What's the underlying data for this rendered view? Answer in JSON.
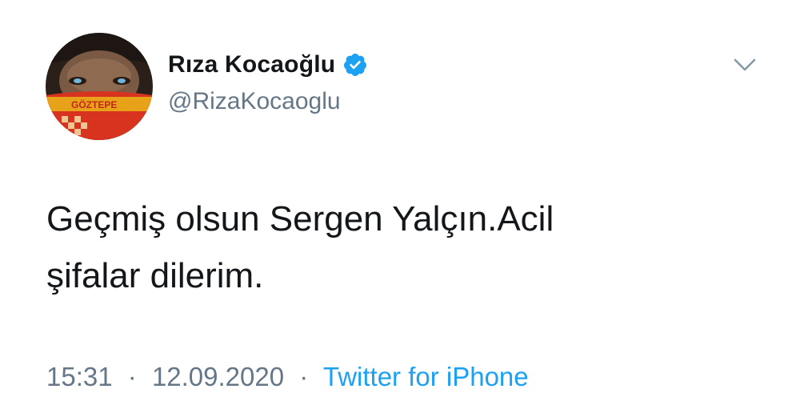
{
  "author": {
    "display_name": "Rıza Kocaoğlu",
    "handle": "@RizaKocaoglu",
    "verified": true,
    "avatar_icon": "profile-photo-goztepe-scarf",
    "avatar_scarf_text": "GÖZTEPE"
  },
  "menu": {
    "icon": "chevron-down-icon"
  },
  "tweet": {
    "text_lines": [
      "Geçmiş olsun Sergen Yalçın.Acil",
      "şifalar dilerim."
    ]
  },
  "meta": {
    "time": "15:31",
    "separator": "·",
    "date": "12.09.2020",
    "source": "Twitter for iPhone"
  },
  "colors": {
    "text": "#14171a",
    "secondary": "#657786",
    "link": "#1da1f2",
    "verified_badge": "#1da1f2"
  }
}
